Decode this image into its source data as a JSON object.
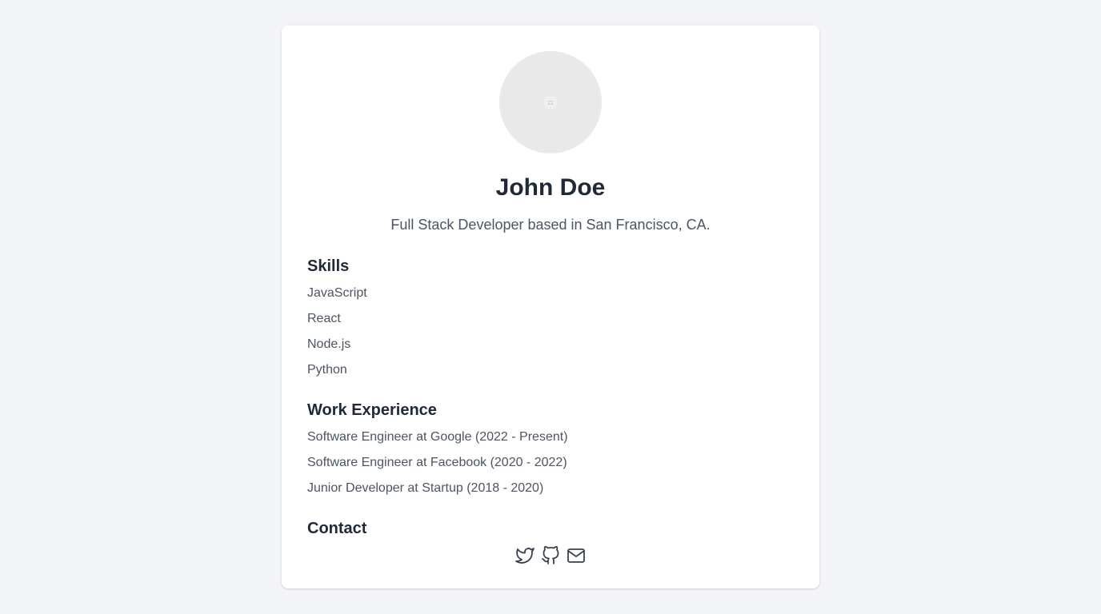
{
  "profile": {
    "name": "John Doe",
    "tagline": "Full Stack Developer based in San Francisco, CA.",
    "avatar_icon": "image-placeholder-icon"
  },
  "skills": {
    "title": "Skills",
    "items": [
      "JavaScript",
      "React",
      "Node.js",
      "Python"
    ]
  },
  "work": {
    "title": "Work Experience",
    "items": [
      "Software Engineer at Google (2022 - Present)",
      "Software Engineer at Facebook (2020 - 2022)",
      "Junior Developer at Startup (2018 - 2020)"
    ]
  },
  "contact": {
    "title": "Contact",
    "icons": [
      "twitter-icon",
      "github-icon",
      "mail-icon"
    ]
  },
  "colors": {
    "background": "#f3f4f6",
    "card": "#ffffff",
    "heading": "#1f2937",
    "body_text": "#4b5563",
    "avatar": "#e9e9e9"
  }
}
